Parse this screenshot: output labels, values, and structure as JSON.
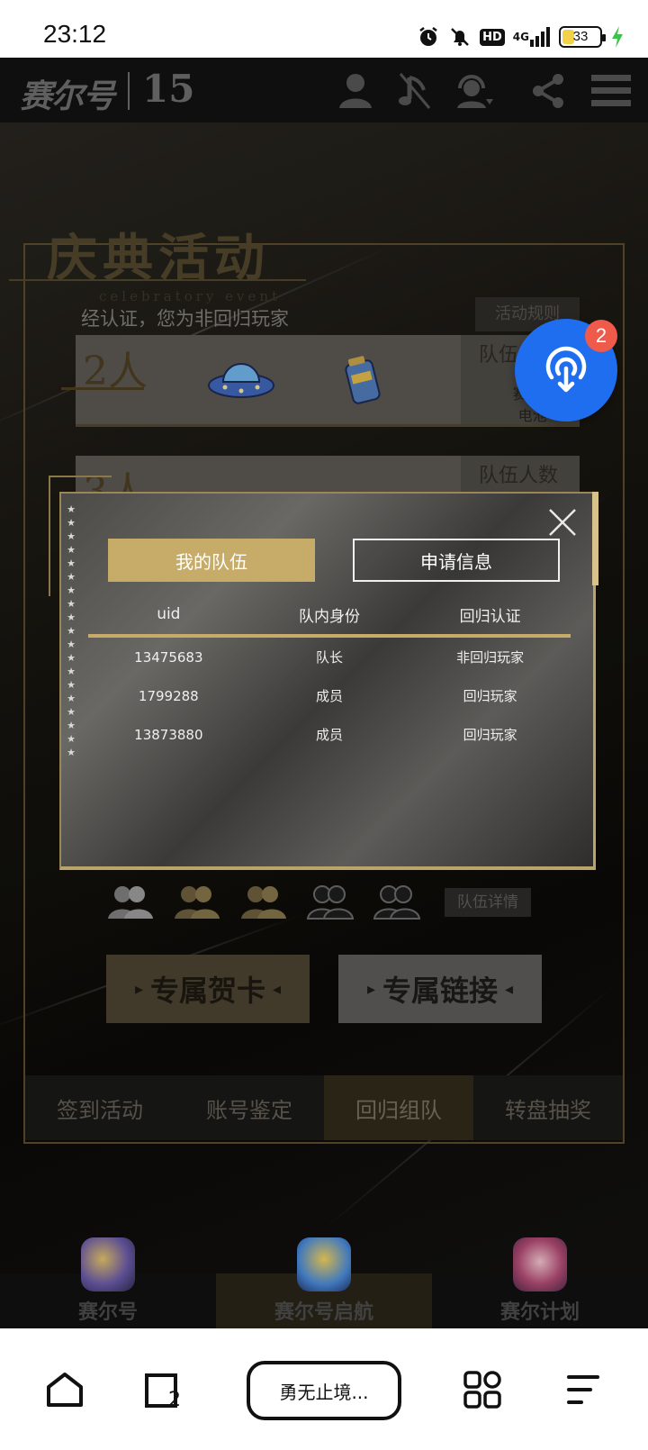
{
  "status_bar": {
    "time": "23:12",
    "icons": [
      "alarm-icon",
      "mute-bell-icon",
      "hd-icon",
      "signal-4g-icon",
      "battery-icon",
      "charging-icon"
    ],
    "hd_label": "HD",
    "network_label": "4G",
    "battery_percent": "33",
    "battery_level": 0.33,
    "battery_color": "#f2d24a",
    "charging_color": "#3ec24a"
  },
  "site_header": {
    "logo_text": "赛尔号",
    "anniversary": "15",
    "icons": [
      "user-icon",
      "music-icon",
      "customer-service-icon",
      "share-icon",
      "menu-icon"
    ]
  },
  "event": {
    "title": "庆典活动",
    "subtitle": "celebratory event",
    "verify_status": "经认证，您为非回归玩家",
    "rules_button": "活动规则",
    "rewards": [
      {
        "count": "2人",
        "label": "队伍",
        "line1": "赛尔豆*5",
        "line2": "电池*88",
        "items": [
          "ufo-icon",
          "battery-item-icon"
        ]
      },
      {
        "count": "3人",
        "label": "队伍人数",
        "line1": "",
        "line2": "",
        "items": []
      }
    ],
    "member_slots": [
      {
        "icon": "member-icon",
        "state": "filled-white"
      },
      {
        "icon": "member-icon",
        "state": "filled-gold"
      },
      {
        "icon": "member-icon",
        "state": "filled-gold"
      },
      {
        "icon": "member-icon",
        "state": "empty"
      },
      {
        "icon": "member-icon",
        "state": "empty"
      }
    ],
    "team_detail_button": "队伍详情",
    "card_button": "专属贺卡",
    "link_button": "专属链接",
    "tabs": [
      {
        "label": "签到活动",
        "active": false
      },
      {
        "label": "账号鉴定",
        "active": false
      },
      {
        "label": "回归组队",
        "active": true
      },
      {
        "label": "转盘抽奖",
        "active": false
      }
    ]
  },
  "game_bar": {
    "games": [
      {
        "label": "赛尔号",
        "active": false,
        "icon": "seer-game-icon"
      },
      {
        "label": "赛尔号启航",
        "active": true,
        "icon": "seer-launch-game-icon"
      },
      {
        "label": "赛尔计划",
        "active": false,
        "icon": "seer-plan-game-icon"
      }
    ]
  },
  "modal": {
    "close_icon": "close-icon",
    "tabs": {
      "my_team": "我的队伍",
      "applications": "申请信息"
    },
    "columns": [
      "uid",
      "队内身份",
      "回归认证"
    ],
    "rows": [
      [
        "13475683",
        "队长",
        "非回归玩家"
      ],
      [
        "1799288",
        "成员",
        "回归玩家"
      ],
      [
        "13873880",
        "成员",
        "回归玩家"
      ]
    ]
  },
  "floating_button": {
    "icon": "broadcast-icon",
    "badge": "2",
    "color": "#1f6ef0",
    "badge_color": "#f05a4a"
  },
  "browser_nav": {
    "address_text": "勇无止境...",
    "tab_count": "2",
    "icons": [
      "home-icon",
      "tabs-icon",
      "apps-icon",
      "menu-lines-icon"
    ]
  },
  "colors": {
    "gold": "#c7ab68",
    "dark_bg": "#121212"
  }
}
